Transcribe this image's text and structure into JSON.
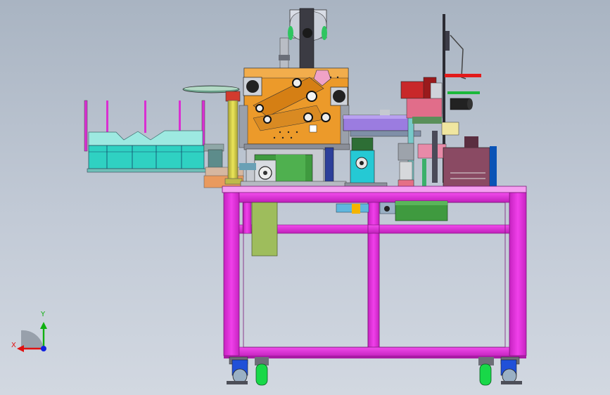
{
  "viewport": {
    "background_top": "#a9b4c2",
    "background_bottom": "#d2d8e1"
  },
  "triad": {
    "x_label": "X",
    "y_label": "Y",
    "x_color": "#e01010",
    "y_color": "#10b010",
    "z_color": "#1020e0"
  },
  "colors": {
    "frame": "#ee33e6",
    "frame_dark": "#a81ca4",
    "orange_block": "#ec9a2a",
    "cyan_tray": "#2fd1c2",
    "olive_plate": "#9ebd5c",
    "yellow_column": "#d8d24a",
    "green_motor": "#3f9a3f",
    "red_motor": "#c8282a",
    "maroon_box": "#8a4a63",
    "purple_beam": "#9b7ce0",
    "blue_wheel": "#2050d8",
    "green_wheel": "#18d848",
    "pink_part": "#e88aa8"
  },
  "icons": [
    "coordinate-triad-icon",
    "axis-arrow-icon",
    "caster-wheel-icon"
  ]
}
